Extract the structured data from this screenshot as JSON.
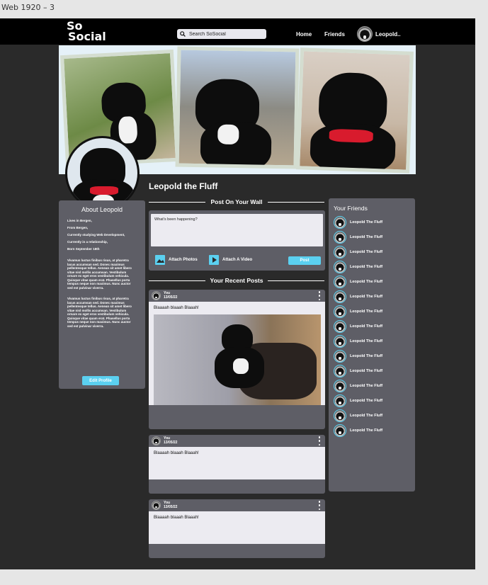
{
  "window": {
    "frame_label": "Web 1920 – 3"
  },
  "header": {
    "logo": {
      "line1": "So",
      "line2": "Social"
    },
    "search_placeholder": "Search SoSocial",
    "nav": {
      "home": "Home",
      "friends": "Friends",
      "user": "Leopold.."
    }
  },
  "profile": {
    "name": "Leopold the Fluff"
  },
  "about": {
    "title": "About Leopold",
    "facts": [
      "Lives in Bergen,",
      "From Bergen,",
      "Currently studying Web Development,",
      "Currently in a relationship,",
      "Born September 18th"
    ],
    "paragraphs": [
      "Vivamus luctus finibus risus, at pharetra lacus accumsan sed. Donec maximus pellentesque tellus. Aenean sit amet libero vitae nisl mollis accumsan. Vestibulum ornare ex eget eros vestibulum vehicula. Quisque vitae quam erat. Phasellus porta tempus neque non maximus. Nunc auctor sed est pulvinar viverra.",
      "Vivamus luctus finibus risus, at pharetra lacus accumsan sed. Donec maximus pellentesque tellus. Aenean sit amet libero vitae nisl mollis accumsan. Vestibulum ornare ex eget eros vestibulum vehicula. Quisque vitae quam erat. Phasellus porta tempus neque non maximus. Nunc auctor sed est pulvinar viverra."
    ],
    "edit_button": "Edit Profile"
  },
  "wall": {
    "title": "Post On Your Wall",
    "placeholder": "What's been happening?",
    "attach_photos": "Attach Photos",
    "attach_video": "Attach A Video",
    "post_button": "Post"
  },
  "recent": {
    "title": "Your Recent Posts",
    "posts": [
      {
        "author": "You",
        "date": "13/05/22",
        "text": "Blaaaah blaaah Blaaah!"
      },
      {
        "author": "You",
        "date": "13/05/22",
        "text": "Blaaaah blaaah Blaaah!"
      },
      {
        "author": "You",
        "date": "13/05/22",
        "text": "Blaaaah blaaah Blaaah!"
      }
    ]
  },
  "friends": {
    "title": "Your Friends",
    "items": [
      "Leopold The Fluff",
      "Leopold The Fluff",
      "Leopold The Fluff",
      "Leopold The Fluff",
      "Leopold The Fluff",
      "Leopold The Fluff",
      "Leopold The Fluff",
      "Leopold The Fluff",
      "Leopold The Fluff",
      "Leopold The Fluff",
      "Leopold The Fluff",
      "Leopold The Fluff",
      "Leopold The Fluff",
      "Leopold The Fluff",
      "Leopold The Fluff"
    ]
  },
  "colors": {
    "background": "#2a2a2a",
    "panel": "#5e5e66",
    "accent": "#5bd0f0",
    "topbar": "#000000"
  }
}
